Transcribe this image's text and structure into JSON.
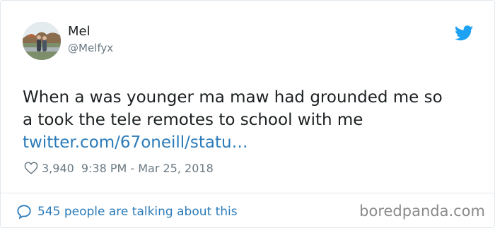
{
  "tweet": {
    "author_name": "Mel",
    "author_handle": "@Melfyx",
    "text_line1": "When a was younger ma maw had grounded me so",
    "text_line2": "a took the tele remotes to school with me",
    "link": "twitter.com/67oneill/statu…",
    "likes": "3,940",
    "timestamp": "9:38 PM - Mar 25, 2018",
    "talking_text": "545 people are talking about this"
  },
  "icons": {
    "brand": "twitter-bird-icon",
    "like": "heart-icon",
    "reply": "speech-bubble-icon"
  },
  "colors": {
    "link": "#2b7bb9",
    "twitter_blue": "#1da1f2",
    "muted_text": "#697882",
    "body_text": "#1c2022"
  },
  "watermark": "boredpanda.com"
}
